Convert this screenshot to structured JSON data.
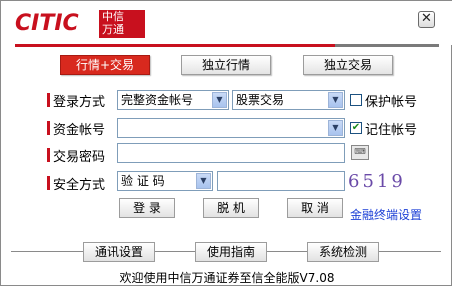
{
  "brand": {
    "logo_text": "CITIC",
    "logo_cn_line1": "中信",
    "logo_cn_line2": "万通",
    "accent_color": "#c8101e"
  },
  "window": {
    "close_label": "✕"
  },
  "tabs": [
    {
      "label": "行情+交易",
      "active": true
    },
    {
      "label": "独立行情",
      "active": false
    },
    {
      "label": "独立交易",
      "active": false
    }
  ],
  "form": {
    "login_method_label": "登录方式",
    "login_method_value": "完整资金帐号",
    "login_type_value": "股票交易",
    "protect_account_label": "保护帐号",
    "protect_account_checked": false,
    "fund_account_label": "资金帐号",
    "fund_account_value": "",
    "remember_account_label": "记住帐号",
    "remember_account_checked": true,
    "password_label": "交易密码",
    "password_value": "",
    "security_label": "安全方式",
    "security_value": "验 证 码",
    "security_input_value": "",
    "captcha_text": "6519"
  },
  "actions": {
    "login": "登 录",
    "offline": "脱 机",
    "cancel": "取 消",
    "terminal_settings": "金融终端设置"
  },
  "bottom_buttons": {
    "comm_settings": "通讯设置",
    "guide": "使用指南",
    "system_check": "系统检测"
  },
  "footer": "欢迎使用中信万通证券至信全能版V7.08"
}
